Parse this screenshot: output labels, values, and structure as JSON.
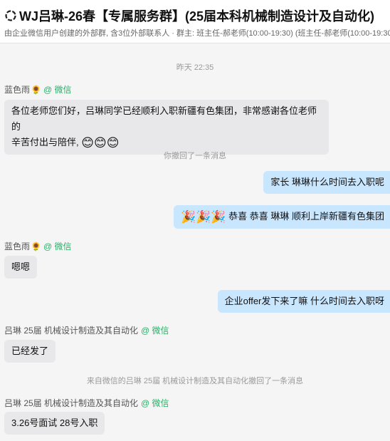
{
  "header": {
    "title": "WJ吕琳-26春【专属服务群】(25届本科机械制造设计及自动化)",
    "subtitle": "由企业微信用户创建的外部群, 含3位外部联系人 · 群主: 班主任-郝老师(10:00-19:30)   (班主任-郝老师(10:00-19:30"
  },
  "chat": {
    "timestamp": "昨天 22:35",
    "sender1": {
      "name": "蓝色雨",
      "badge": "@ 微信"
    },
    "msg1_line1": "各位老师您们好，吕琳同学已经顺利入职新疆有色集团，非常感谢各位老师的",
    "msg1_line2": "辛苦付出与陪伴,",
    "msg1_emoji": "😊😊😊",
    "recall1": "你撤回了一条消息",
    "out1": "家长 琳琳什么时间去入职呢",
    "out2_emoji": "🎉🎉🎉",
    "out2": "恭喜 恭喜 琳琳 顺利上岸新疆有色集团",
    "sender2": {
      "name": "蓝色雨",
      "badge": "@ 微信"
    },
    "msg2": "嗯嗯",
    "out3": "企业offer发下来了嘛 什么时间去入职呀",
    "sender3": {
      "name": "吕琳 25届 机械设计制造及其自动化",
      "badge": "@ 微信"
    },
    "msg3": "已经发了",
    "recall2": "来自微信的吕琳 25届 机械设计制造及其自动化撤回了一条消息",
    "sender4": {
      "name": "吕琳 25届 机械设计制造及其自动化",
      "badge": "@ 微信"
    },
    "msg4": "3.26号面试 28号入职"
  },
  "icons": {
    "group": "group-ring-icon",
    "flower": "sunflower-icon"
  }
}
